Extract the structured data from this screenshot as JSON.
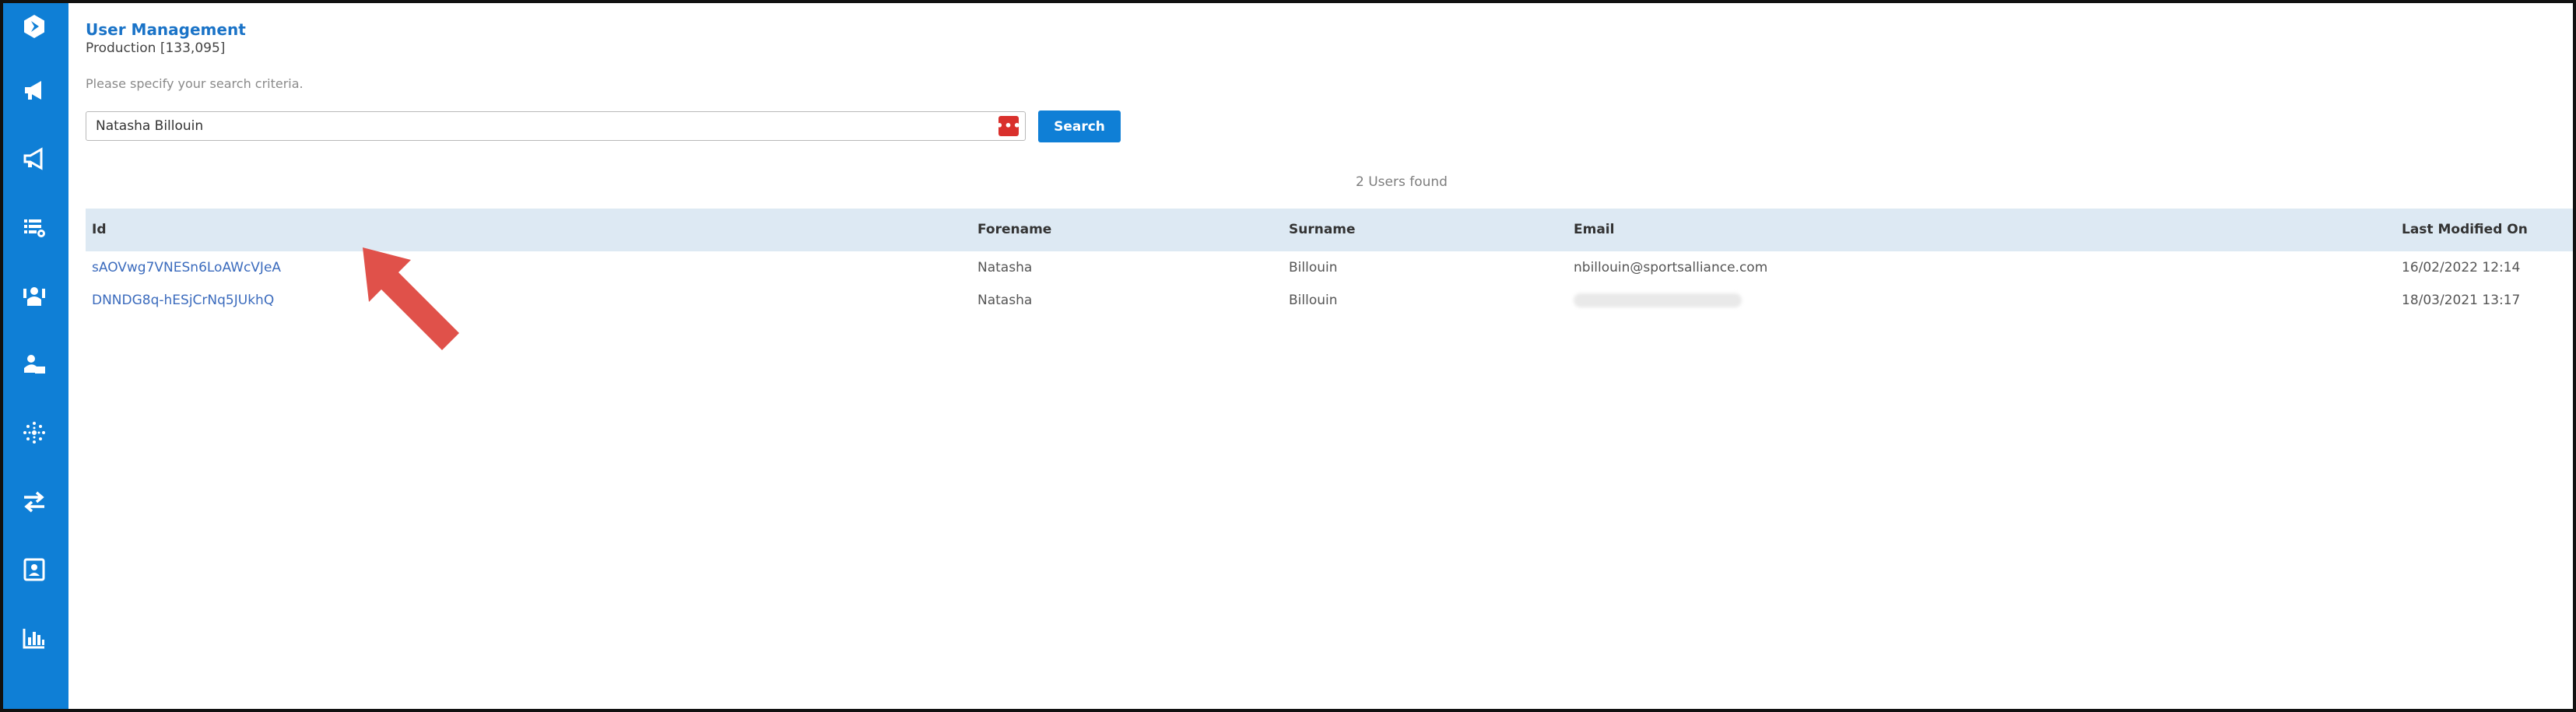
{
  "header": {
    "title": "User Management",
    "subtitle": "Production [133,095]"
  },
  "search": {
    "criteria_text": "Please specify your search criteria.",
    "value": "Natasha Billouin",
    "button_label": "Search",
    "password_icon": "ellipsis-key-icon"
  },
  "results": {
    "summary": "2 Users found",
    "columns": {
      "id": "Id",
      "forename": "Forename",
      "surname": "Surname",
      "email": "Email",
      "modified": "Last Modified On"
    },
    "rows": [
      {
        "id": "sAOVwg7VNESn6LoAWcVJeA",
        "forename": "Natasha",
        "surname": "Billouin",
        "email": "nbillouin@sportsalliance.com",
        "modified": "16/02/2022 12:14"
      },
      {
        "id": "DNNDG8q-hESjCrNq5JUkhQ",
        "forename": "Natasha",
        "surname": "Billouin",
        "email": "",
        "modified": "18/03/2021 13:17"
      }
    ]
  },
  "sidebar": {
    "icons": [
      "logo-icon",
      "megaphone-icon",
      "megaphone-outline-icon",
      "list-settings-icon",
      "user-gesture-icon",
      "user-upload-icon",
      "sparkle-icon",
      "transfer-arrows-icon",
      "contact-card-icon",
      "bar-chart-icon"
    ]
  },
  "colors": {
    "brand_blue": "#0f7fd6",
    "link_blue": "#3b6bbd",
    "header_row": "#dde9f3",
    "annotation_red": "#e0514a"
  }
}
